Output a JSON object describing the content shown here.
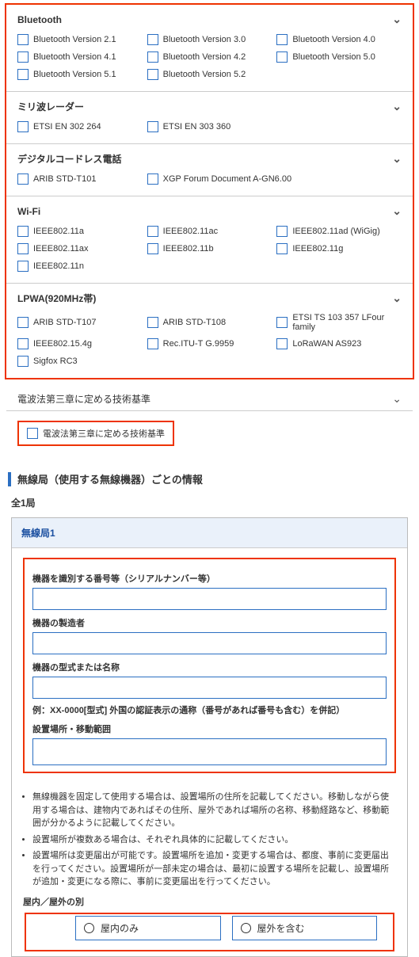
{
  "sections": {
    "bluetooth": {
      "title": "Bluetooth",
      "items": [
        "Bluetooth Version 2.1",
        "Bluetooth Version 3.0",
        "Bluetooth Version 4.0",
        "Bluetooth Version 4.1",
        "Bluetooth Version 4.2",
        "Bluetooth Version 5.0",
        "Bluetooth Version 5.1",
        "Bluetooth Version 5.2"
      ]
    },
    "mmwave": {
      "title": "ミリ波レーダー",
      "items": [
        "ETSI EN 302 264",
        "ETSI EN 303 360"
      ]
    },
    "cordless": {
      "title": "デジタルコードレス電話",
      "items": [
        "ARIB STD-T101",
        "XGP Forum Document A-GN6.00"
      ]
    },
    "wifi": {
      "title": "Wi-Fi",
      "items": [
        "IEEE802.11a",
        "IEEE802.11ac",
        "IEEE802.11ad (WiGig)",
        "IEEE802.11ax",
        "IEEE802.11b",
        "IEEE802.11g",
        "IEEE802.11n"
      ]
    },
    "lpwa": {
      "title": "LPWA(920MHz帯)",
      "items": [
        "ARIB STD-T107",
        "ARIB STD-T108",
        "ETSI TS 103 357 LFour family",
        "IEEE802.15.4g",
        "Rec.ITU-T G.9959",
        "LoRaWAN AS923",
        "Sigfox RC3"
      ]
    }
  },
  "tech_std": {
    "header": "電波法第三章に定める技術基準",
    "item": "電波法第三章に定める技術基準"
  },
  "station_header": "無線局（使用する無線機器）ごとの情報",
  "count_label": "全1局",
  "station": {
    "title": "無線局1",
    "fields": {
      "serial": "機器を識別する番号等（シリアルナンバー等）",
      "maker": "機器の製造者",
      "model": "機器の型式または名称",
      "model_hint": "例：XX-0000[型式] 外国の認証表示の通称（番号があれば番号も含む）を併記）",
      "location": "設置場所・移動範囲"
    },
    "notes": [
      "無線機器を固定して使用する場合は、設置場所の住所を記載してください。移動しながら使用する場合は、建物内であればその住所、屋外であれば場所の名称、移動経路など、移動範囲が分かるように記載してください。",
      "設置場所が複数ある場合は、それぞれ具体的に記載してください。",
      "設置場所は変更届出が可能です。設置場所を追加・変更する場合は、都度、事前に変更届出を行ってください。設置場所が一部未定の場合は、最初に設置する場所を記載し、設置場所が追加・変更になる際に、事前に変更届出を行ってください。"
    ],
    "indoor_label": "屋内／屋外の別",
    "radio": {
      "indoor": "屋内のみ",
      "outdoor": "屋外を含む"
    }
  }
}
